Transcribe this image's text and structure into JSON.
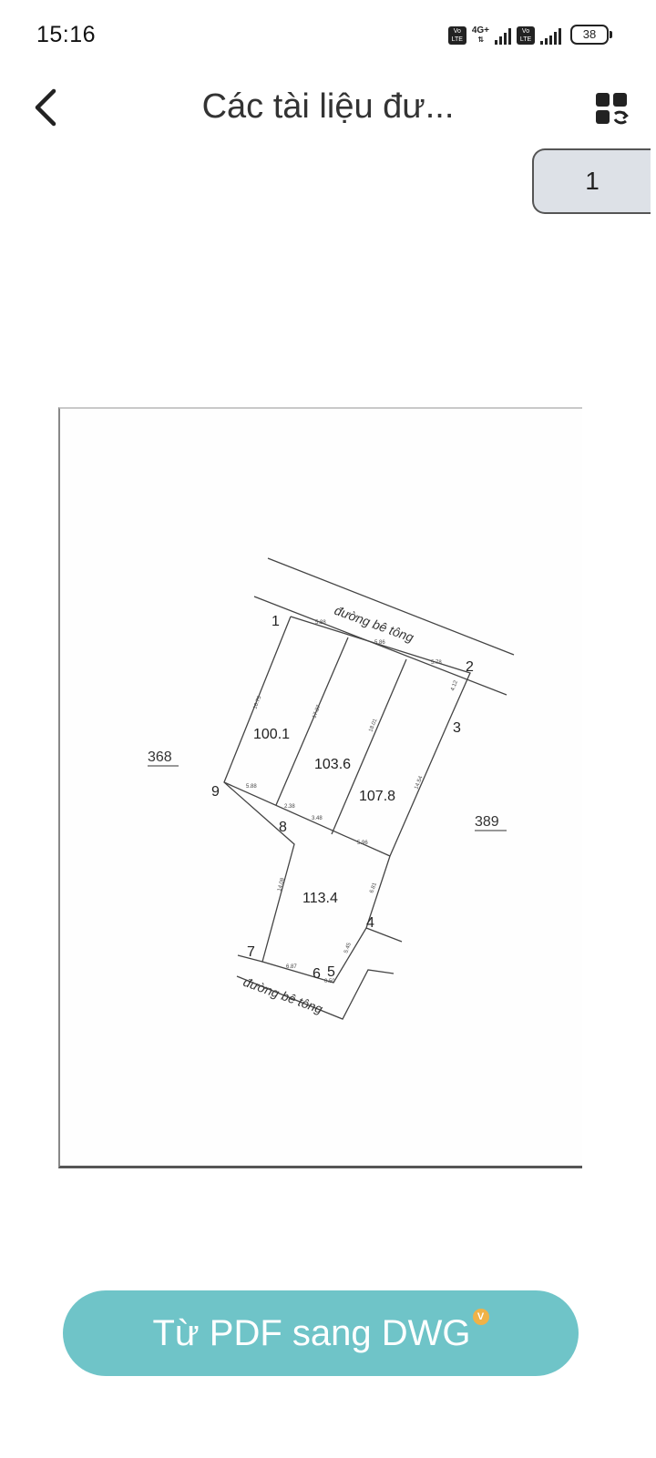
{
  "status_bar": {
    "time": "15:16",
    "volte_label": "Vo LTE",
    "network": "4G+",
    "battery": "38"
  },
  "app_bar": {
    "title": "Các tài liệu đư..."
  },
  "page_indicator": "1",
  "document": {
    "road_top": "đường bê tông",
    "road_bottom": "đường bê tông",
    "neighbor_left": "368",
    "neighbor_right": "389",
    "areas": [
      "100.1",
      "103.6",
      "107.8",
      "113.4"
    ],
    "points": [
      "1",
      "2",
      "3",
      "4",
      "5",
      "6",
      "7",
      "8",
      "9"
    ],
    "dims": [
      "5.88",
      "5.86",
      "5.78",
      "4.12",
      "16.75",
      "17.37",
      "18.01",
      "14.54",
      "5.88",
      "2.38",
      "3.48",
      "5.96",
      "14.08",
      "6.81",
      "5.45",
      "6.87",
      "0.50"
    ]
  },
  "action_button": {
    "label": "Từ PDF sang DWG",
    "badge": "V"
  }
}
